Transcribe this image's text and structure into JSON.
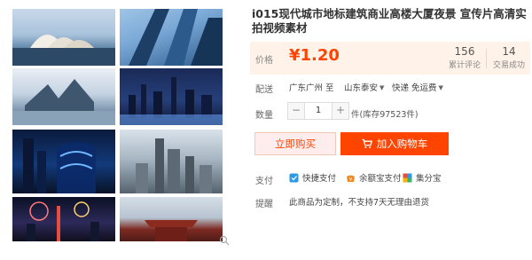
{
  "product": {
    "title": "i015现代城市地标建筑商业高楼大厦夜景 宣传片高清实拍视频素材"
  },
  "price": {
    "label": "价格",
    "value": "¥1.20",
    "currency_color": "#ff4400"
  },
  "stats": {
    "reviews_count": "156",
    "reviews_label": "累计评论",
    "sales_count": "14",
    "sales_label": "交易成功"
  },
  "shipping": {
    "label": "配送",
    "origin": "广东广州 至",
    "destination": "山东泰安",
    "delivery": "快递 免运费"
  },
  "quantity": {
    "label": "数量",
    "minus": "−",
    "value": "1",
    "plus": "+",
    "stock": "件(库存97523件)"
  },
  "actions": {
    "buy_now": "立即购买",
    "add_to_cart": "加入购物车"
  },
  "payment": {
    "label": "支付",
    "methods": [
      "快捷支付",
      "余额宝支付",
      "集分宝"
    ]
  },
  "notice": {
    "label": "提醒",
    "text": "此商品为定制，不支持7天无理由退货"
  },
  "icons": [
    "cart-icon",
    "quick-pay-icon",
    "yuebao-icon",
    "jifenbao-icon",
    "zoom-icon"
  ],
  "colors": {
    "accent": "#ff4400",
    "price_panel_bg": "#fff2e8"
  }
}
